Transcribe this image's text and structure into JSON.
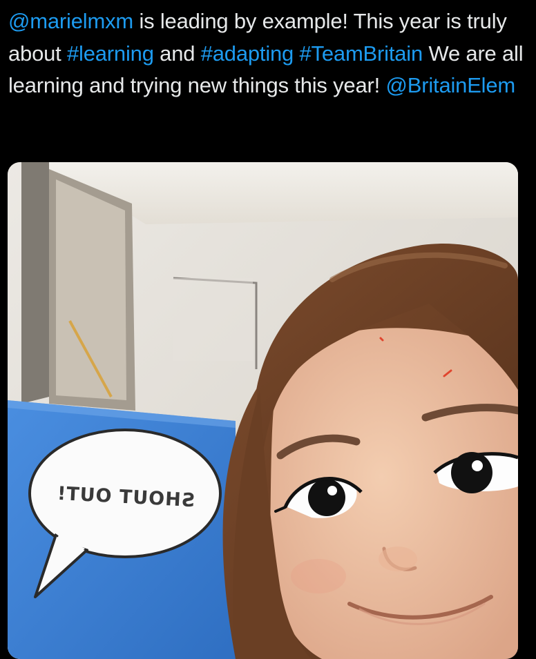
{
  "tweet": {
    "mention_author": "@marielmxm",
    "text_1": " is leading by example! This year is truly about ",
    "hashtag_1": "#learning",
    "text_2": " and ",
    "hashtag_2": "#adapting",
    "text_3": " ",
    "hashtag_3": "#TeamBritain",
    "text_4": " We are all learning and trying new things this year!  ",
    "mention_2": "@BritainElem"
  },
  "media": {
    "bubble_text": "SHOUT OUT!"
  },
  "colors": {
    "background": "#000000",
    "text": "#e7e9ea",
    "link": "#1d9bf0",
    "board": "#3c7fd4"
  }
}
